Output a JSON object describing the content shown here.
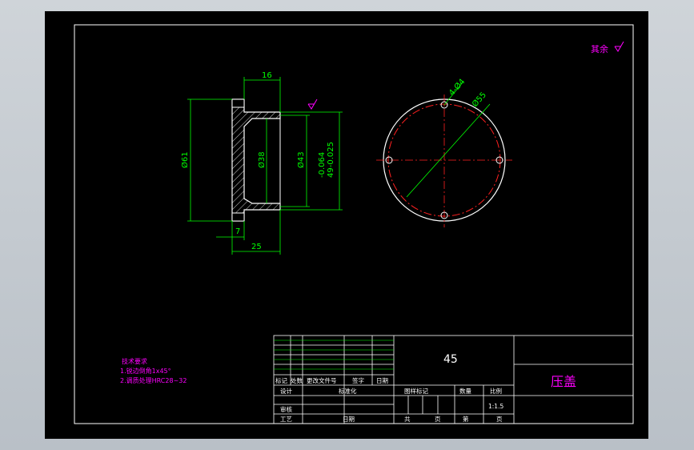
{
  "roughness": {
    "label": "其余"
  },
  "dimensions": {
    "d16": "16",
    "d61": "Ø61",
    "d38": "Ø38",
    "d43": "Ø43",
    "tol": "49-0.025",
    "tol2": "-0.064",
    "d7": "7",
    "d25": "25",
    "hole": "4-Ø4",
    "pcd": "Ø55"
  },
  "notes": {
    "title": "技术要求",
    "line1": "1.锐边倒角1x45°",
    "line2": "2.调质处理HRC28~32"
  },
  "title_block": {
    "material": "45",
    "part_name": "压盖",
    "rev_headers": [
      "标记",
      "处数",
      "更改文件号",
      "签字",
      "日期"
    ],
    "design": "设计",
    "standard": "标准化",
    "review": "审核",
    "process": "工艺",
    "date": "日期",
    "stage_mark": "图样标记",
    "weight": "数量",
    "scale_label": "比例",
    "scale": "1:1.5",
    "total": "共",
    "sheet": "页",
    "page_label": "第",
    "page_unit": "页"
  },
  "colors": {
    "background": "#000000",
    "line": "#ffffff",
    "dimension": "#00ff00",
    "center_line": "#ff2020",
    "annotation": "#ff00ff"
  }
}
